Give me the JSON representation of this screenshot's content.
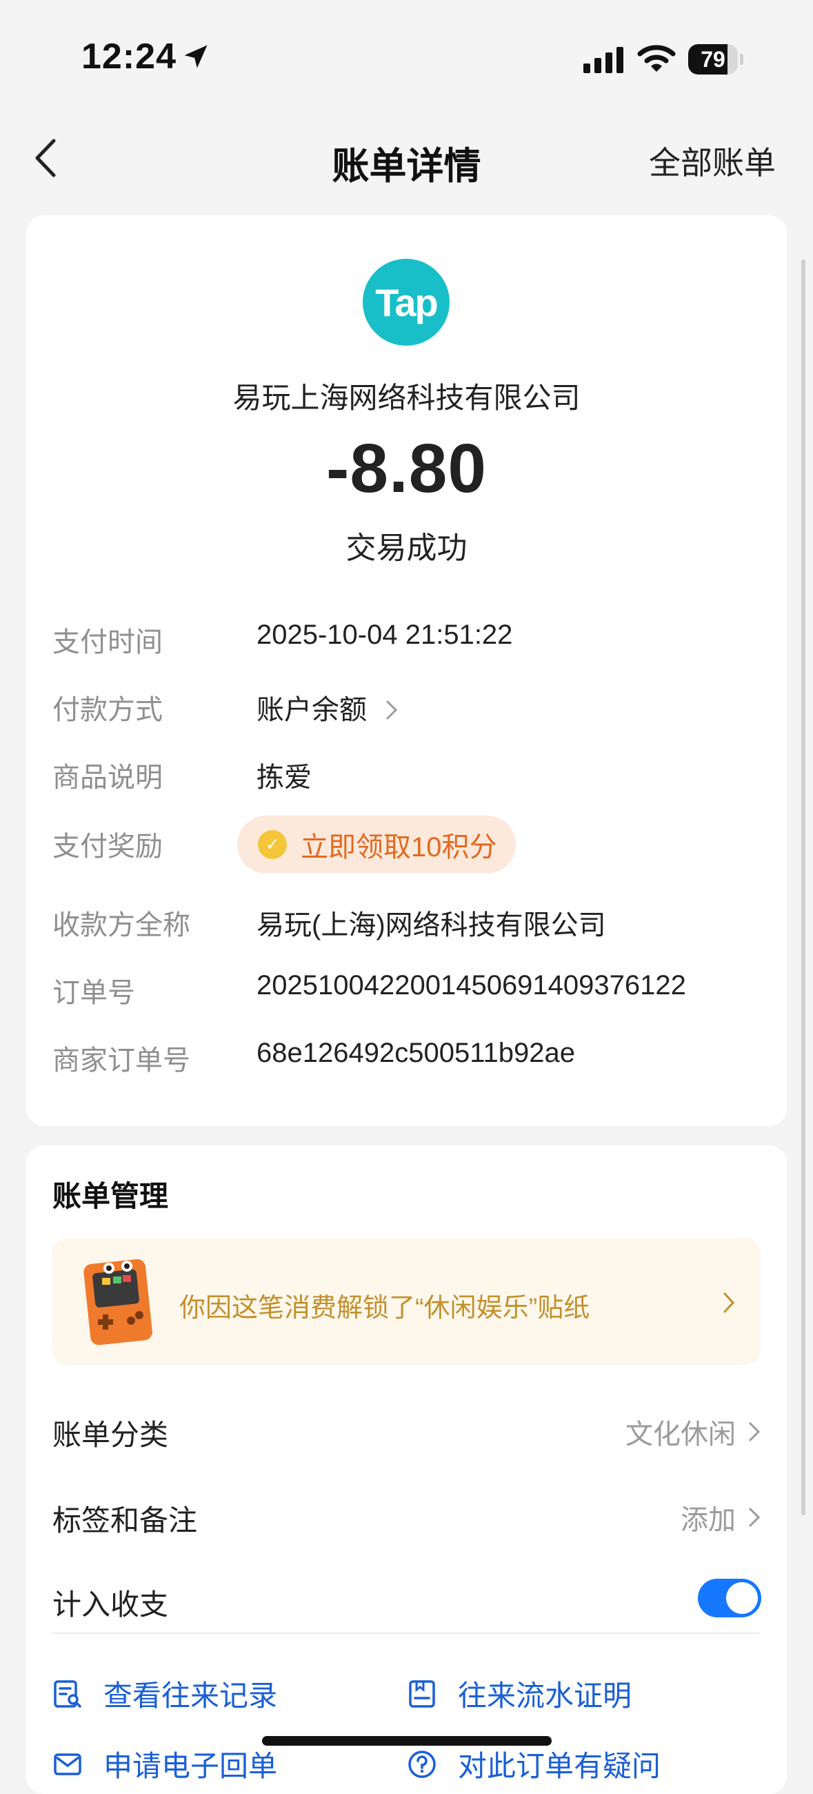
{
  "status_bar": {
    "time": "12:24",
    "battery": "79",
    "battery_level": 0.79
  },
  "nav": {
    "title": "账单详情",
    "right_link": "全部账单"
  },
  "summary": {
    "logo_text": "Tap",
    "logo_color": "#19bfc8",
    "merchant": "易玩上海网络科技有限公司",
    "amount": "-8.80",
    "status": "交易成功"
  },
  "details": {
    "pay_time_label": "支付时间",
    "pay_time_value": "2025-10-04 21:51:22",
    "method_label": "付款方式",
    "method_value": "账户余额",
    "goods_label": "商品说明",
    "goods_value": "拣爱",
    "reward_label": "支付奖励",
    "reward_value": "立即领取10积分",
    "payee_label": "收款方全称",
    "payee_value": "易玩(上海)网络科技有限公司",
    "order_label": "订单号",
    "order_value": "2025100422001450691409376122",
    "merchant_order_label": "商家订单号",
    "merchant_order_value": "68e126492c500511b92ae"
  },
  "management": {
    "title": "账单管理",
    "sticker_text": "你因这笔消费解锁了“休闲娱乐”贴纸",
    "category_label": "账单分类",
    "category_value": "文化休闲",
    "tags_label": "标签和备注",
    "tags_value": "添加",
    "include_label": "计入收支",
    "include_enabled": true,
    "links": {
      "records": "查看往来记录",
      "proof": "往来流水证明",
      "receipt": "申请电子回单",
      "question": "对此订单有疑问"
    }
  },
  "colors": {
    "accent": "#1677ff",
    "reward_text": "#e2691f",
    "sticker_text": "#c3902c"
  }
}
